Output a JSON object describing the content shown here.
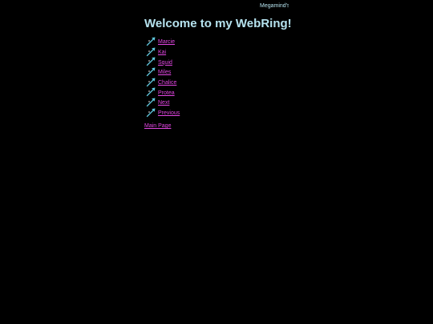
{
  "marquee": {
    "text": "Megamind's WebRing"
  },
  "page": {
    "title": "Welcome to my WebRing!"
  },
  "ring": {
    "icon": "arrow-pointer-icon",
    "items": [
      {
        "label": "Marcie"
      },
      {
        "label": "Kai"
      },
      {
        "label": "Squid"
      },
      {
        "label": "Miles"
      },
      {
        "label": "Chalice"
      },
      {
        "label": "Protea"
      },
      {
        "label": "Next"
      },
      {
        "label": "Previous"
      }
    ]
  },
  "footer": {
    "main_link": "Main Page"
  },
  "colors": {
    "background": "#000000",
    "title": "#b6e3ef",
    "link": "#e246e2",
    "icon": "#5fc7dd"
  }
}
